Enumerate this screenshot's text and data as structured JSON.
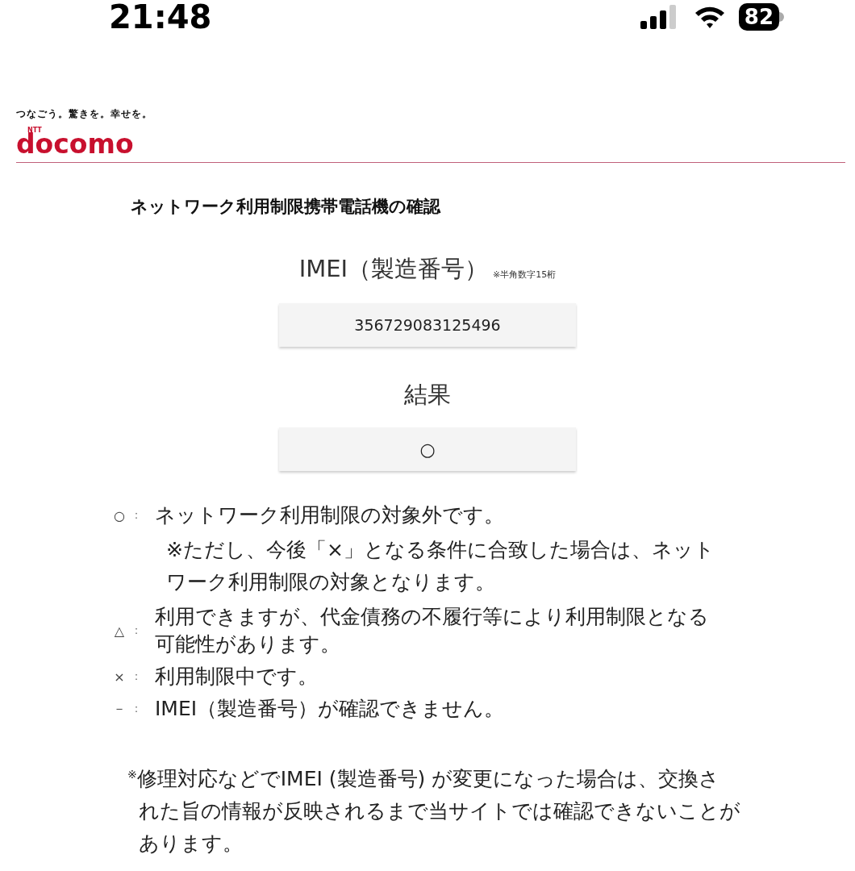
{
  "status_bar": {
    "time": "21:48",
    "battery": "82"
  },
  "header": {
    "tagline": "つなごう。驚きを。幸せを。",
    "logo_small": "NTT",
    "logo": "docomo"
  },
  "title": "ネットワーク利用制限携帯電話機の確認",
  "imei": {
    "label": "IMEI（製造番号）",
    "hint": "※半角数字15桁",
    "value": "356729083125496"
  },
  "result": {
    "label": "結果",
    "value": "○"
  },
  "legend": [
    {
      "symbol": "○",
      "separator": "：",
      "text": "ネットワーク利用制限の対象外です。",
      "note": "※ただし、今後「×」となる条件に合致した場合は、ネットワーク利用制限の対象となります。"
    },
    {
      "symbol": "△",
      "separator": "：",
      "text": "利用できますが、代金債務の不履行等により利用制限となる可能性があります。"
    },
    {
      "symbol": "×",
      "separator": "：",
      "text": "利用制限中です。"
    },
    {
      "symbol": "－",
      "separator": "：",
      "text": "IMEI（製造番号）が確認できません。"
    }
  ],
  "footnote": "$^{※}$修理対応などでIMEI (製造番号) が変更になった場合は、交換された旨の情報が反映されるまで当サイトでは確認できないことがあります。"
}
